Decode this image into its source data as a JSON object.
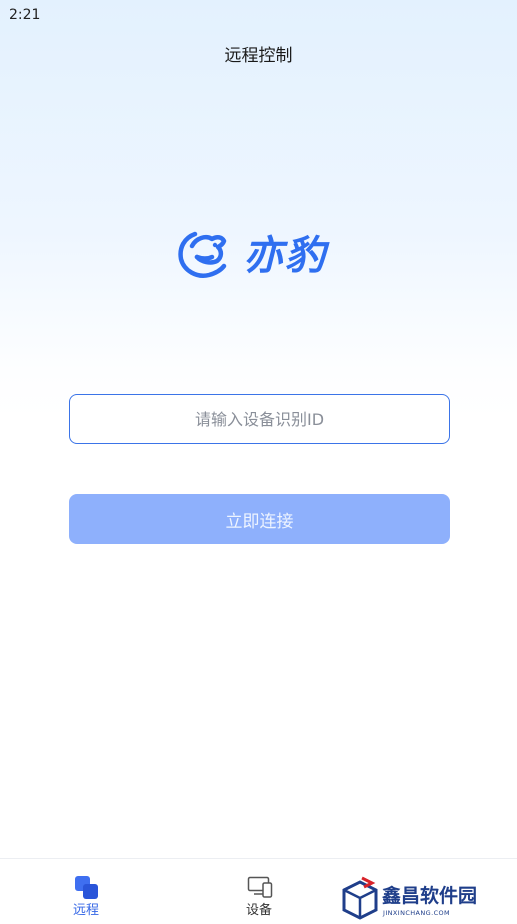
{
  "status_bar": {
    "time": "2:21"
  },
  "header": {
    "title": "远程控制"
  },
  "brand": {
    "logo_text": "亦豹",
    "accent_color": "#2f6ff0"
  },
  "connect_form": {
    "device_id_placeholder": "请输入设备识别ID",
    "device_id_value": "",
    "connect_label": "立即连接"
  },
  "tab_bar": {
    "tabs": [
      {
        "label": "远程",
        "icon": "remote-icon",
        "active": true
      },
      {
        "label": "设备",
        "icon": "devices-icon",
        "active": false
      }
    ]
  },
  "watermark": {
    "name": "鑫昌软件园",
    "url": "JINXINCHANG.COM"
  }
}
